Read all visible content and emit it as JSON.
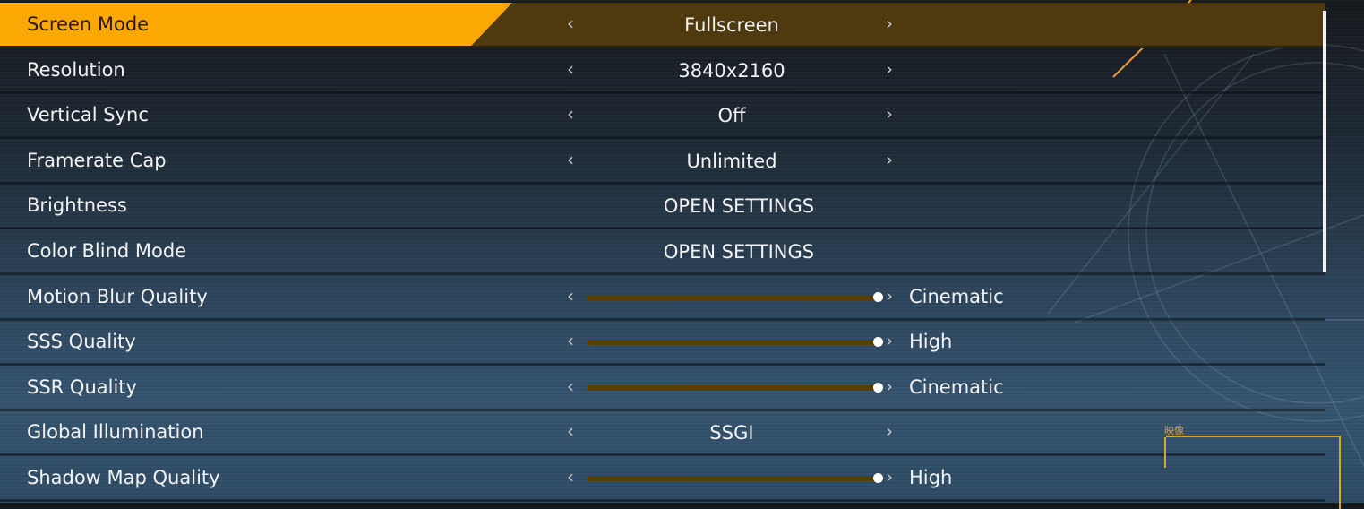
{
  "rows": [
    {
      "label": "Screen Mode",
      "type": "select",
      "value": "Fullscreen",
      "selected": true
    },
    {
      "label": "Resolution",
      "type": "select",
      "value": "3840x2160"
    },
    {
      "label": "Vertical Sync",
      "type": "select",
      "value": "Off"
    },
    {
      "label": "Framerate Cap",
      "type": "select",
      "value": "Unlimited"
    },
    {
      "label": "Brightness",
      "type": "button",
      "value": "OPEN SETTINGS"
    },
    {
      "label": "Color Blind Mode",
      "type": "button",
      "value": "OPEN SETTINGS"
    },
    {
      "label": "Motion Blur Quality",
      "type": "slider",
      "value": "Cinematic",
      "level": 1.0
    },
    {
      "label": "SSS Quality",
      "type": "slider",
      "value": "High",
      "level": 1.0
    },
    {
      "label": "SSR Quality",
      "type": "slider",
      "value": "Cinematic",
      "level": 1.0
    },
    {
      "label": "Global Illumination",
      "type": "select",
      "value": "SSGI"
    },
    {
      "label": "Shadow Map Quality",
      "type": "slider",
      "value": "High",
      "level": 1.0
    }
  ],
  "arrows": {
    "left": "‹",
    "right": "›"
  },
  "minimap": {
    "label": "映像"
  },
  "colors": {
    "accent": "#fba704",
    "selected_row": "#4e3a0e",
    "slider_track": "#5a3f05"
  }
}
